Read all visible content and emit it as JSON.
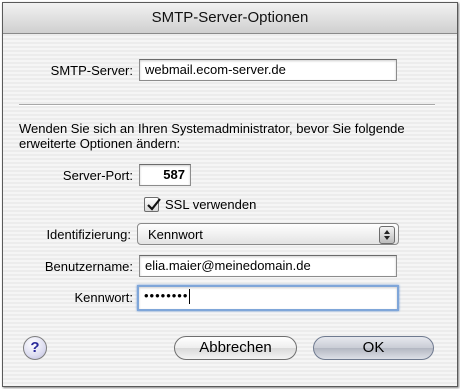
{
  "window": {
    "title": "SMTP-Server-Optionen"
  },
  "smtp": {
    "label": "SMTP-Server:",
    "value": "webmail.ecom-server.de"
  },
  "notice": "Wenden Sie sich an Ihren Systemadministrator, bevor Sie folgende erweiterte Optionen ändern:",
  "port": {
    "label": "Server-Port:",
    "value": "587"
  },
  "ssl": {
    "label": "SSL verwenden",
    "checked": true
  },
  "auth": {
    "label": "Identifizierung:",
    "selected": "Kennwort"
  },
  "username": {
    "label": "Benutzername:",
    "value": "elia.maier@meinedomain.de"
  },
  "password": {
    "label": "Kennwort:",
    "value": "••••••••"
  },
  "buttons": {
    "cancel": "Abbrechen",
    "ok": "OK",
    "help": "?"
  },
  "icons": {
    "checkmark": "checkmark-icon",
    "popup": "updown-arrows-icon",
    "help": "help-icon"
  }
}
